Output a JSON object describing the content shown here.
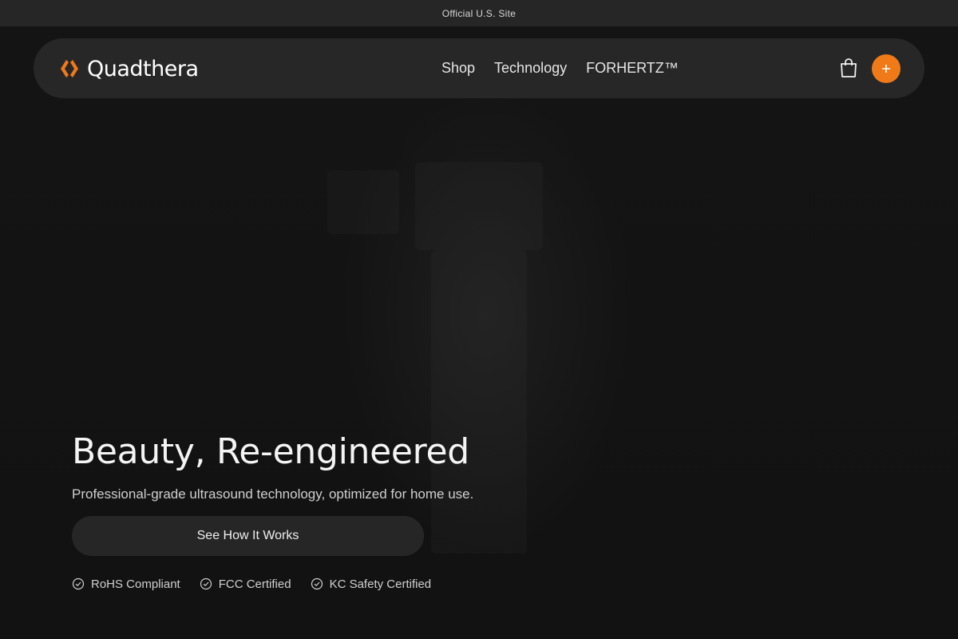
{
  "announcement": {
    "text": "Official U.S. Site"
  },
  "brand": {
    "name": "Quadthera",
    "accent": "#f07a18"
  },
  "nav": {
    "links": [
      {
        "label": "Shop"
      },
      {
        "label": "Technology"
      },
      {
        "label": "FORHERTZ™"
      }
    ],
    "cart_icon": "shopping-bag-icon",
    "action_icon": "plus-icon"
  },
  "hero": {
    "headline": "Beauty, Re-engineered",
    "subtitle": "Professional-grade ultrasound technology, optimized for home use.",
    "cta_label": "See How It Works",
    "certifications": [
      {
        "label": "RoHS Compliant",
        "icon": "check-circle-icon"
      },
      {
        "label": "FCC Certified",
        "icon": "check-circle-icon"
      },
      {
        "label": "KC Safety Certified",
        "icon": "check-circle-icon"
      }
    ]
  }
}
